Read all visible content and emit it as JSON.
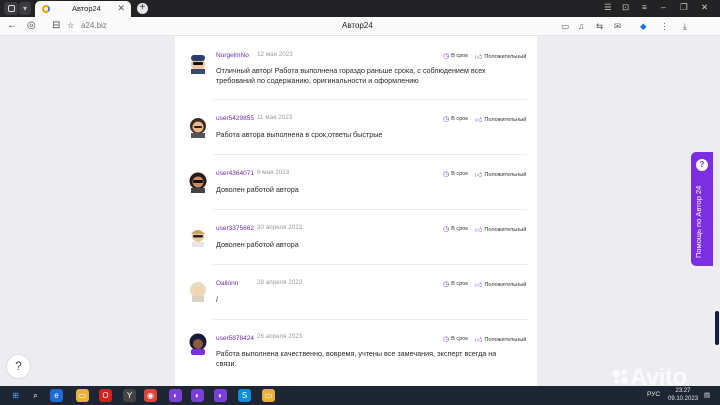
{
  "browser": {
    "tab_title": "Автор24",
    "url": "a24.biz",
    "page_title": "Автор24",
    "new_tab_symbol": "+",
    "close_symbol": "✕"
  },
  "reviews": [
    {
      "user": "NurgelmNo",
      "date": "12 мая 2023",
      "on_time": "В срок",
      "rating": "Положительный",
      "text": "Отличный автор! Работа выполнена гораздо раньше срока, с соблюдением всех требований по содержанию, оригинальности и оформлению",
      "avatar": "user-avatar-cap"
    },
    {
      "user": "user5429855",
      "date": "11 мая 2023",
      "on_time": "В срок",
      "rating": "Положительный",
      "text": "Работа автора выполнена в срок,ответы быстрые",
      "avatar": "user-avatar-woman"
    },
    {
      "user": "user4364071",
      "date": "6 мая 2023",
      "on_time": "В срок",
      "rating": "Положительный",
      "text": "Доволен работой автора",
      "avatar": "user-avatar-sunglasses"
    },
    {
      "user": "user3375662",
      "date": "30 апреля 2023",
      "on_time": "В срок",
      "rating": "Положительный",
      "text": "Доволен работой автора",
      "avatar": "user-avatar-glasses"
    },
    {
      "user": "Oallonn",
      "date": "28 апреля 2023",
      "on_time": "В срок",
      "rating": "Положительный",
      "text": "/",
      "avatar": "user-avatar-blonde"
    },
    {
      "user": "user5878424",
      "date": "26 апреля 2023",
      "on_time": "В срок",
      "rating": "Положительный",
      "text": "Работа выполнена качественно, вовремя, учтены все замечания, эксперт всегда на связи.",
      "avatar": "user-avatar-curly"
    }
  ],
  "help_tab": {
    "label": "Помощь по Автор 24",
    "icon": "?"
  },
  "chat_button": {
    "icon": "?"
  },
  "taskbar": {
    "lang": "РУС",
    "time": "23:27",
    "date": "09.10.2023"
  },
  "watermark": "Avito",
  "colors": {
    "accent": "#7b2fe0",
    "username": "#6a2bb5",
    "taskbar": "#1f2633"
  }
}
